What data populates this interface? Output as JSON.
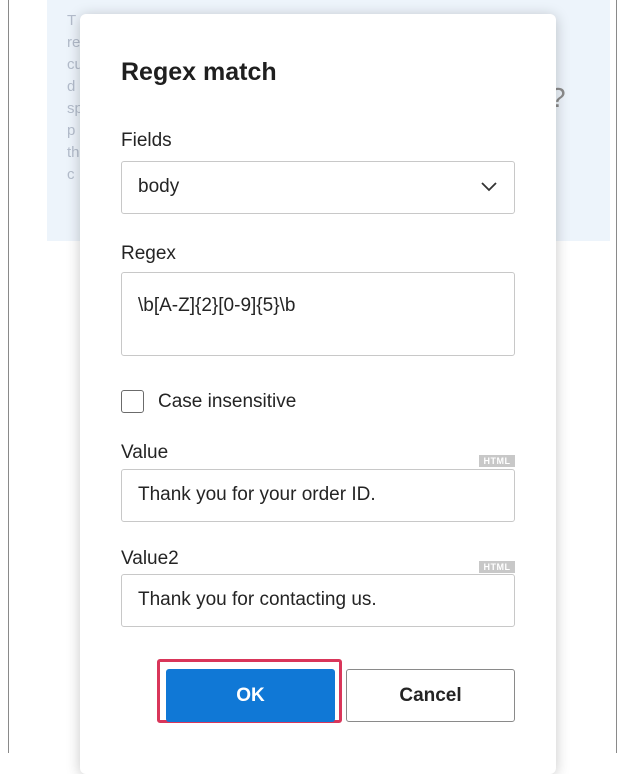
{
  "background": {
    "letters": [
      "T",
      "re",
      "cu",
      "d",
      "sp",
      "p",
      "th",
      "c"
    ],
    "question_mark": "?"
  },
  "dialog": {
    "title": "Regex match",
    "fields": {
      "label": "Fields",
      "selected": "body"
    },
    "regex": {
      "label": "Regex",
      "value": "\\b[A-Z]{2}[0-9]{5}\\b"
    },
    "case_insensitive": {
      "label": "Case insensitive",
      "checked": false
    },
    "value": {
      "label": "Value",
      "badge": "HTML",
      "text": "Thank you for your order ID."
    },
    "value2": {
      "label": "Value2",
      "badge": "HTML",
      "text": "Thank you for contacting us."
    },
    "buttons": {
      "ok": "OK",
      "cancel": "Cancel"
    }
  },
  "colors": {
    "accent": "#1078d6",
    "highlight": "#d9365a",
    "background_panel": "#edf4fb"
  },
  "icons": {
    "dropdown": "chevron-down-icon"
  }
}
